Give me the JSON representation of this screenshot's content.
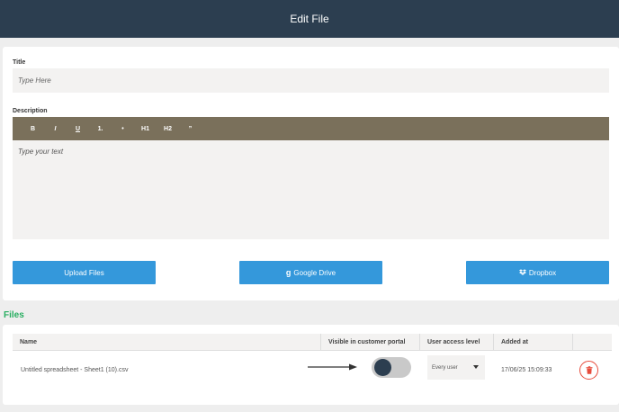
{
  "header": {
    "title": "Edit File"
  },
  "form": {
    "title_label": "Title",
    "title_placeholder": "Type Here",
    "description_label": "Description",
    "description_placeholder": "Type your text",
    "toolbar": {
      "bold": "B",
      "italic": "I",
      "underline": "U",
      "ordered_list": "1.",
      "bullet_list": "•",
      "h1": "H1",
      "h2": "H2",
      "quote": "”"
    },
    "buttons": {
      "upload": "Upload Files",
      "google_drive": "Google Drive",
      "google_drive_icon": "g",
      "dropbox": "Dropbox"
    }
  },
  "files": {
    "heading": "Files",
    "columns": [
      "Name",
      "Visible in customer portal",
      "User access level",
      "Added at",
      ""
    ],
    "rows": [
      {
        "name": "Untitled spreadsheet - Sheet1 (10).csv",
        "visible": false,
        "access_level": "Every user",
        "added_at": "17/06/25 15:09:33"
      }
    ]
  },
  "colors": {
    "header_bg": "#2c3e50",
    "toolbar_bg": "#7a705b",
    "button_bg": "#3498db",
    "files_heading": "#27ae60",
    "delete_red": "#e74c3c"
  }
}
